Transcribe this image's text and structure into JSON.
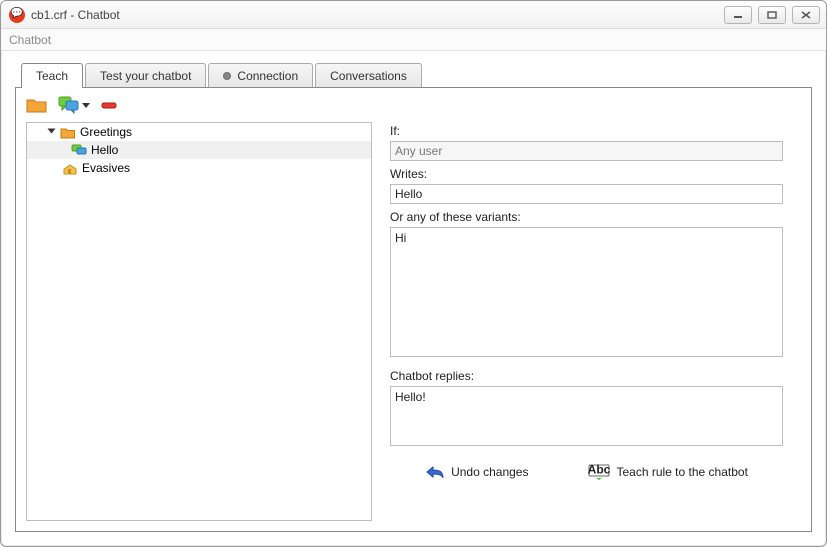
{
  "window": {
    "title": "cb1.crf - Chatbot"
  },
  "menu": {
    "items": [
      "Chatbot"
    ]
  },
  "tabs": [
    {
      "label": "Teach",
      "active": true
    },
    {
      "label": "Test your chatbot",
      "active": false
    },
    {
      "label": "Connection",
      "active": false,
      "indicator": true
    },
    {
      "label": "Conversations",
      "active": false
    }
  ],
  "toolbar": {
    "new_folder_icon": "folder-icon",
    "new_rule_icon": "chat-icon",
    "delete_icon": "minus-icon"
  },
  "tree": {
    "nodes": [
      {
        "label": "Greetings",
        "icon": "folder",
        "depth": 1,
        "expanded": true
      },
      {
        "label": "Hello",
        "icon": "chat",
        "depth": 2,
        "selected": true
      },
      {
        "label": "Evasives",
        "icon": "house",
        "depth": 1
      }
    ]
  },
  "form": {
    "if_label": "If:",
    "if_value": "Any user",
    "writes_label": "Writes:",
    "writes_value": "Hello",
    "variants_label": "Or any of these variants:",
    "variants_value": "Hi",
    "replies_label": "Chatbot replies:",
    "replies_value": "Hello!"
  },
  "actions": {
    "undo_label": "Undo changes",
    "teach_label": "Teach rule to the chatbot"
  }
}
